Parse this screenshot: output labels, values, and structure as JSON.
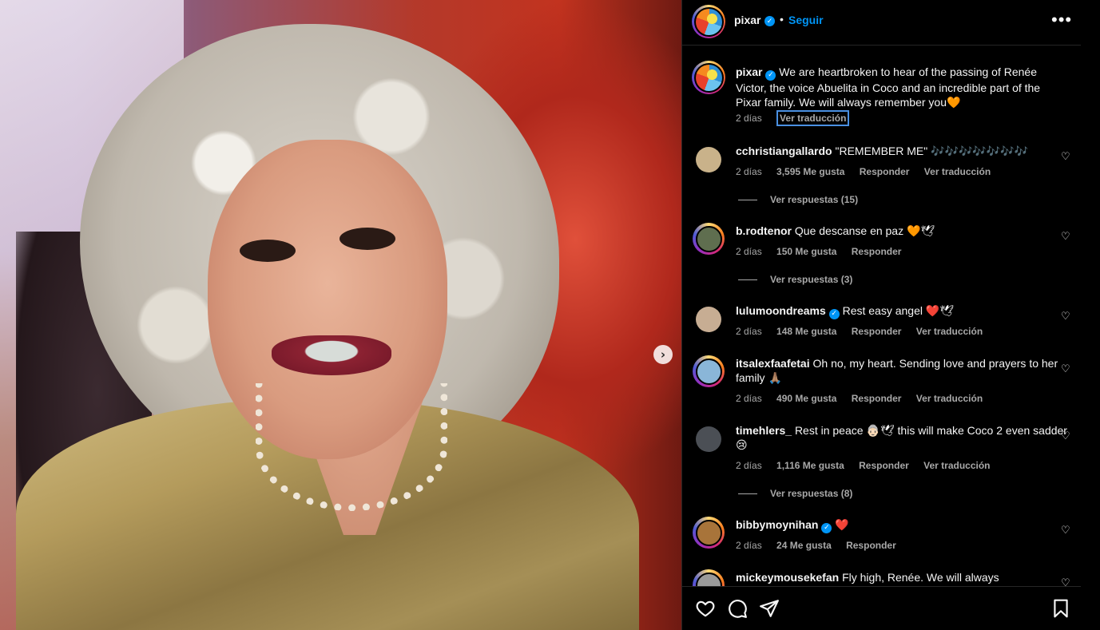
{
  "post": {
    "username": "pixar",
    "follow_label": "Seguir",
    "separator": "•",
    "more_label": "•••",
    "next_label": "›"
  },
  "caption": {
    "username": "pixar",
    "text": "We are heartbroken to hear of the passing of Renée Victor, the voice Abuelita in Coco and an incredible part of the Pixar family. We will always remember you🧡",
    "time": "2 días",
    "translate_label": "Ver traducción"
  },
  "comments": [
    {
      "username": "cchristiangallardo",
      "text": "\"REMEMBER ME\" 🎶🎶🎶🎶🎶🎶🎶",
      "time": "2 días",
      "likes": "3,595 Me gusta",
      "reply_label": "Responder",
      "translate_label": "Ver traducción",
      "replies_label": "Ver respuestas (15)",
      "avatar_color": "#c9b28a"
    },
    {
      "username": "b.rodtenor",
      "text": "Que descanse en paz 🧡🕊",
      "time": "2 días",
      "likes": "150 Me gusta",
      "reply_label": "Responder",
      "replies_label": "Ver respuestas (3)",
      "avatar_color": "#5f6e4f"
    },
    {
      "username": "lulumoondreams",
      "text": "Rest easy angel ❤️🕊",
      "time": "2 días",
      "likes": "148 Me gusta",
      "reply_label": "Responder",
      "translate_label": "Ver traducción",
      "avatar_color": "#c7ad93"
    },
    {
      "username": "itsalexfaafetai",
      "text": "Oh no, my heart. Sending love and prayers to her family 🙏🏽",
      "time": "2 días",
      "likes": "490 Me gusta",
      "reply_label": "Responder",
      "translate_label": "Ver traducción",
      "avatar_color": "#8ab6d8"
    },
    {
      "username": "timehlers_",
      "text": "Rest in peace 👵🏻🕊 this will make Coco 2 even sadder😢",
      "time": "2 días",
      "likes": "1,116 Me gusta",
      "reply_label": "Responder",
      "translate_label": "Ver traducción",
      "replies_label": "Ver respuestas (8)",
      "avatar_color": "#4b4f55"
    },
    {
      "username": "bibbymoynihan",
      "text": "❤️",
      "time": "2 días",
      "likes": "24 Me gusta",
      "reply_label": "Responder",
      "avatar_color": "#a8743a"
    },
    {
      "username": "mickeymousekefan",
      "text": "Fly high, Renée. We will always",
      "avatar_color": "#9a9a9a"
    }
  ],
  "colors": {
    "accent": "#0095f6",
    "muted_text": "#a8a8a8",
    "background": "#000000"
  }
}
